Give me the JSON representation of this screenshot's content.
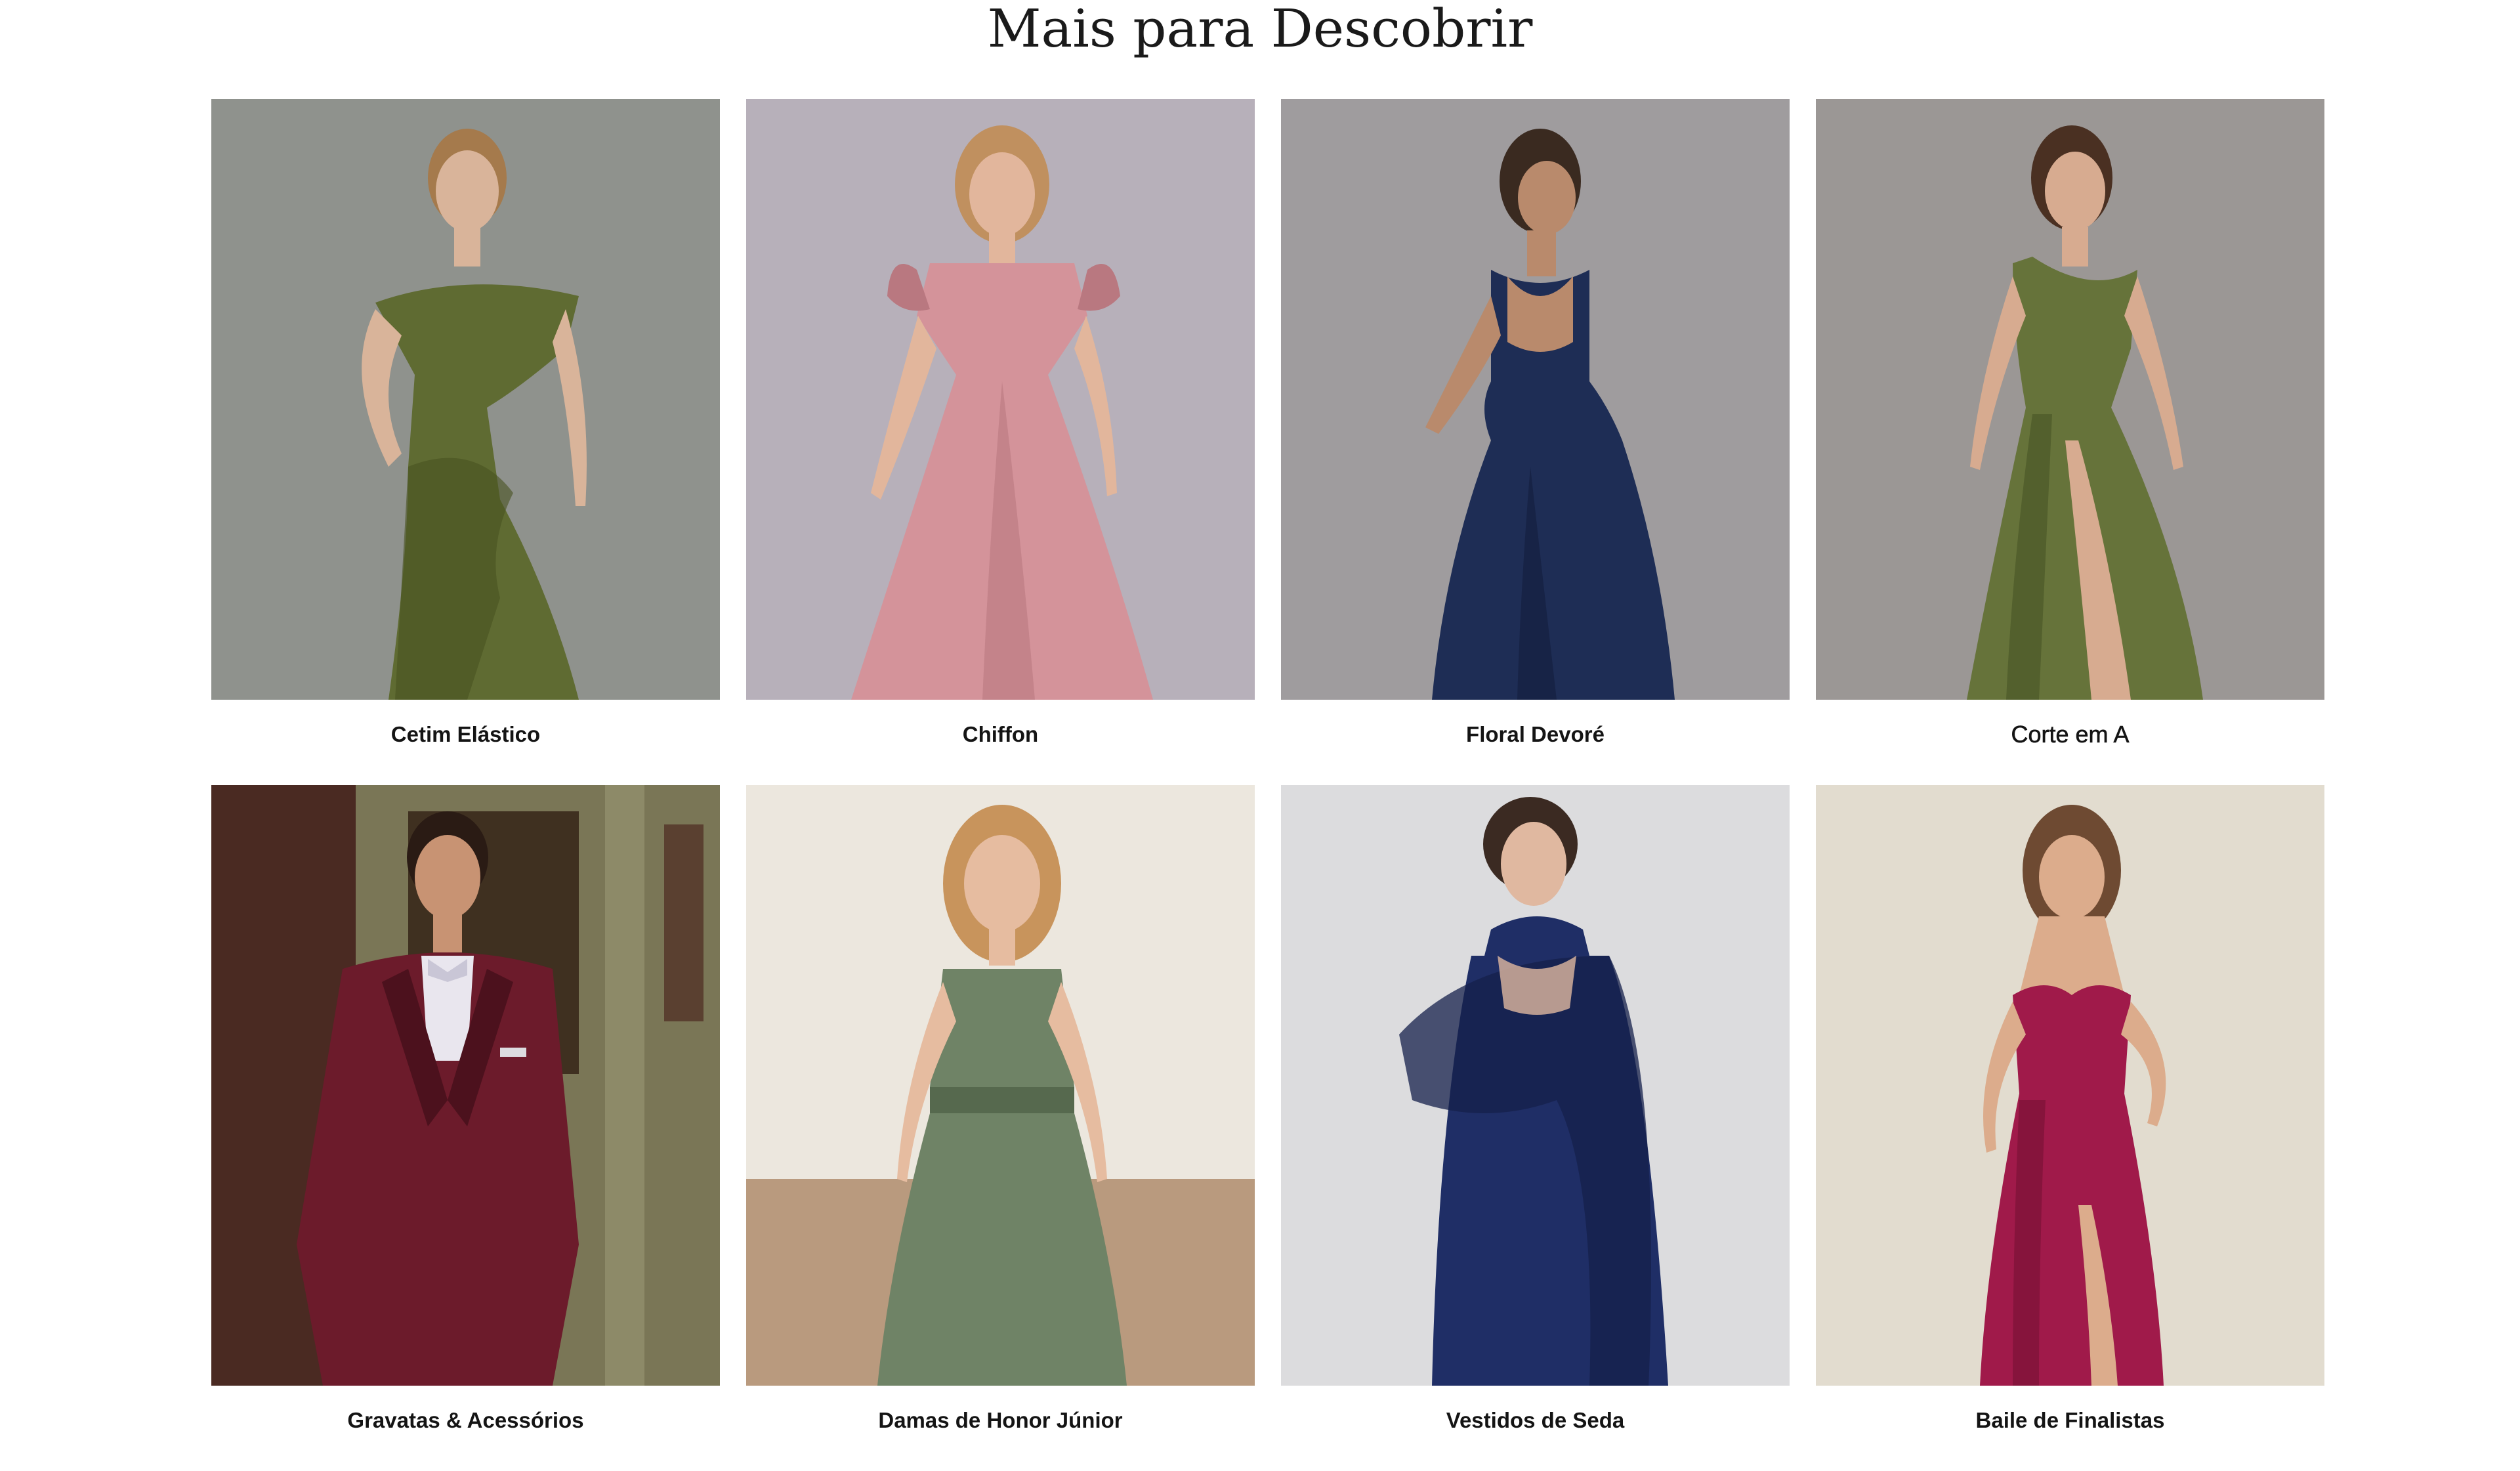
{
  "section": {
    "title": "Mais para Descobrir"
  },
  "categories": [
    {
      "label": "Cetim Elástico",
      "image": "green-satin-off-shoulder-dress",
      "colors": {
        "bg": "#8f928d",
        "garment": "#5f6b32",
        "garment_shade": "#47521f",
        "skin": "#d9b49a",
        "hair": "#a57a4c"
      }
    },
    {
      "label": "Chiffon",
      "image": "pink-chiffon-flutter-sleeve-dress",
      "colors": {
        "bg": "#b7b0ba",
        "garment": "#d4939a",
        "garment_shade": "#b97880",
        "skin": "#e2b69c",
        "hair": "#c0905f"
      }
    },
    {
      "label": "Floral Devoré",
      "image": "navy-floral-midi-dress-back-view",
      "colors": {
        "bg": "#9f9c9e",
        "garment": "#1e2d55",
        "garment_shade": "#142040",
        "skin": "#b98a6c",
        "hair": "#3a2a20"
      }
    },
    {
      "label": "Corte em A",
      "image": "olive-one-shoulder-gown",
      "colors": {
        "bg": "#9b9795",
        "garment": "#66733a",
        "garment_shade": "#4c5828",
        "skin": "#d7ab90",
        "hair": "#4a3022"
      }
    },
    {
      "label": "Gravatas & Acessórios",
      "image": "burgundy-three-piece-suit",
      "colors": {
        "bg": "#6f5a3a",
        "garment": "#6c1b2b",
        "garment_shade": "#4c111d",
        "skin": "#c89373",
        "hair": "#2a1b14"
      }
    },
    {
      "label": "Damas de Honor Júnior",
      "image": "sage-junior-bridesmaid-dress",
      "colors": {
        "bg": "#d7cfc4",
        "garment": "#6f8366",
        "garment_shade": "#56694e",
        "skin": "#e6bca0",
        "hair": "#c8945c"
      }
    },
    {
      "label": "Vestidos de Seda",
      "image": "navy-silk-dress-chiffon-cape",
      "colors": {
        "bg": "#dcdcde",
        "garment": "#1f2e66",
        "garment_shade": "#15204b",
        "skin": "#e0b8a0",
        "hair": "#3b2a22"
      }
    },
    {
      "label": "Baile de Finalistas",
      "image": "magenta-strapless-prom-gown",
      "colors": {
        "bg": "#e2dccf",
        "garment": "#a01a4a",
        "garment_shade": "#7a1236",
        "skin": "#dcac8c",
        "hair": "#6e4a32"
      }
    }
  ]
}
